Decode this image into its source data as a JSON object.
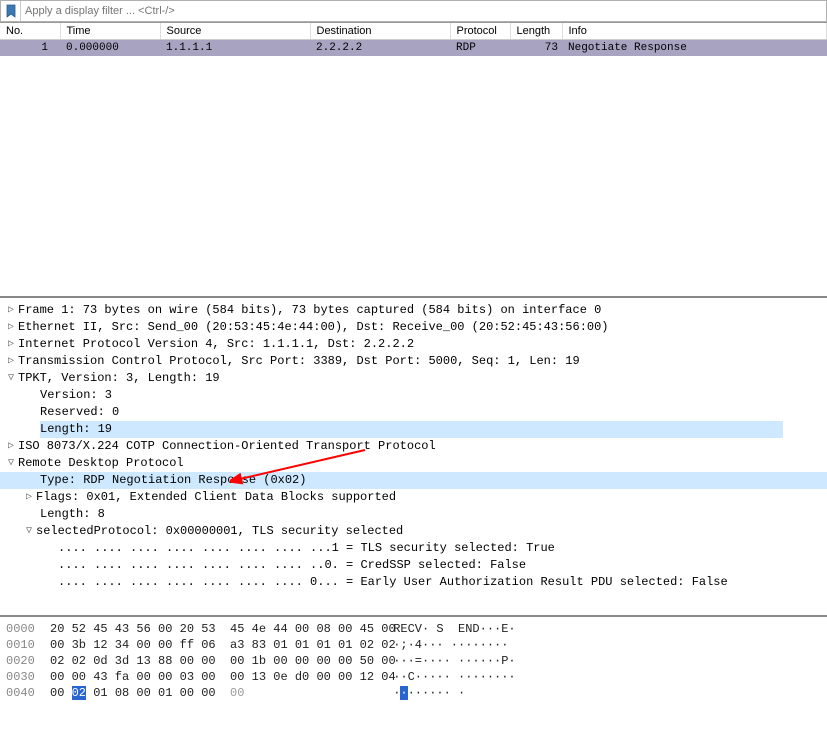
{
  "filter": {
    "placeholder": "Apply a display filter ... <Ctrl-/>"
  },
  "packet_list": {
    "headers": [
      "No.",
      "Time",
      "Source",
      "Destination",
      "Protocol",
      "Length",
      "Info"
    ],
    "rows": [
      {
        "no": "1",
        "time": "0.000000",
        "source": "1.1.1.1",
        "dest": "2.2.2.2",
        "proto": "RDP",
        "len": "73",
        "info": "Negotiate Response"
      }
    ]
  },
  "details": {
    "frame": "Frame 1: 73 bytes on wire (584 bits), 73 bytes captured (584 bits) on interface 0",
    "eth": "Ethernet II, Src: Send_00 (20:53:45:4e:44:00), Dst: Receive_00 (20:52:45:43:56:00)",
    "ip": "Internet Protocol Version 4, Src: 1.1.1.1, Dst: 2.2.2.2",
    "tcp": "Transmission Control Protocol, Src Port: 3389, Dst Port: 5000, Seq: 1, Len: 19",
    "tpkt": "TPKT, Version: 3, Length: 19",
    "tpkt_version": "Version: 3",
    "tpkt_reserved": "Reserved: 0",
    "tpkt_length": "Length: 19",
    "cotp": "ISO 8073/X.224 COTP Connection-Oriented Transport Protocol",
    "rdp": "Remote Desktop Protocol",
    "rdp_type": "Type: RDP Negotiation Response (0x02)",
    "rdp_flags": "Flags: 0x01, Extended Client Data Blocks supported",
    "rdp_len": "Length: 8",
    "rdp_selproto": "selectedProtocol: 0x00000001, TLS security selected",
    "rdp_sp1": ".... .... .... .... .... .... .... ...1 = TLS security selected: True",
    "rdp_sp2": ".... .... .... .... .... .... .... ..0. = CredSSP selected: False",
    "rdp_sp3": ".... .... .... .... .... .... .... 0... = Early User Authorization Result PDU selected: False"
  },
  "hex": {
    "rows": [
      {
        "off": "0000",
        "a": "20 52 45 43 56 00 20 53 ",
        "b": " 45 4e 44 00 08 00 45 00",
        "ascii": " RECV· S  END···E·"
      },
      {
        "off": "0010",
        "a": "00 3b 12 34 00 00 ff 06 ",
        "b": " a3 83 01 01 01 01 02 02",
        "ascii": " ·;·4··· ········"
      },
      {
        "off": "0020",
        "a": "02 02 0d 3d 13 88 00 00 ",
        "b": " 00 1b 00 00 00 00 50 00",
        "ascii": " ···=···· ······P·"
      },
      {
        "off": "0030",
        "a": "00 00 43 fa 00 00 03 00 ",
        "b": " 00 13 0e d0 00 00 12 04",
        "ascii": " ··C····· ········"
      },
      {
        "off": "0040",
        "a": "00 ",
        "hl": "02",
        "a2": " 01 08 00 01 00 00 ",
        "b": " 00",
        "ascii_pre": " ·",
        "ascii_hl": "·",
        "ascii_post": "······ ·"
      }
    ]
  }
}
